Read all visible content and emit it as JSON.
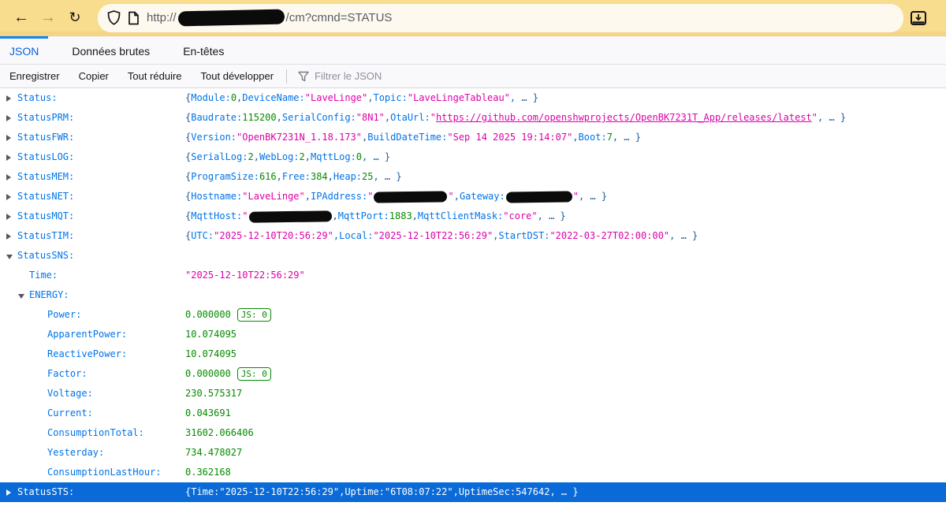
{
  "colors": {
    "chrome_yellow": "#f9dd8e",
    "urlbar_cream": "#fdf9ee",
    "accent_blue": "#0a84ff",
    "key_blue": "#0074e8",
    "string_magenta": "#dd00a9",
    "number_green": "#058b00",
    "selection_blue": "#0a6bd8"
  },
  "browser": {
    "back_icon": "←",
    "forward_icon": "→",
    "reload_icon": "↻",
    "url_prefix": "http://",
    "url_suffix": "/cm?cmnd=STATUS"
  },
  "tabs": [
    {
      "label": "JSON",
      "active": true
    },
    {
      "label": "Données brutes",
      "active": false
    },
    {
      "label": "En-têtes",
      "active": false
    }
  ],
  "toolbar": {
    "save_label": "Enregistrer",
    "copy_label": "Copier",
    "collapse_label": "Tout réduire",
    "expand_label": "Tout développer",
    "filter_placeholder": "Filtrer le JSON"
  },
  "json_tree": {
    "rows": [
      {
        "name": "Status:",
        "level": 0,
        "twisty": "c",
        "selected": false,
        "parts": [
          {
            "t": "d",
            "v": "{ "
          },
          {
            "t": "k",
            "v": "Module: "
          },
          {
            "t": "n",
            "v": "0"
          },
          {
            "t": "d",
            "v": ", "
          },
          {
            "t": "k",
            "v": "DeviceName: "
          },
          {
            "t": "s",
            "v": "\"LaveLinge\""
          },
          {
            "t": "d",
            "v": ", "
          },
          {
            "t": "k",
            "v": "Topic: "
          },
          {
            "t": "s",
            "v": "\"LaveLingeTableau\""
          },
          {
            "t": "d",
            "v": ", … }"
          }
        ]
      },
      {
        "name": "StatusPRM:",
        "level": 0,
        "twisty": "c",
        "selected": false,
        "parts": [
          {
            "t": "d",
            "v": "{ "
          },
          {
            "t": "k",
            "v": "Baudrate: "
          },
          {
            "t": "n",
            "v": "115200"
          },
          {
            "t": "d",
            "v": ", "
          },
          {
            "t": "k",
            "v": "SerialConfig: "
          },
          {
            "t": "s",
            "v": "\"8N1\""
          },
          {
            "t": "d",
            "v": ", "
          },
          {
            "t": "k",
            "v": "OtaUrl: "
          },
          {
            "t": "s",
            "v": "\""
          },
          {
            "t": "l",
            "v": "https://github.com/openshwprojects/OpenBK7231T_App/releases/latest"
          },
          {
            "t": "s",
            "v": "\""
          },
          {
            "t": "d",
            "v": ", … }"
          }
        ]
      },
      {
        "name": "StatusFWR:",
        "level": 0,
        "twisty": "c",
        "selected": false,
        "parts": [
          {
            "t": "d",
            "v": "{ "
          },
          {
            "t": "k",
            "v": "Version: "
          },
          {
            "t": "s",
            "v": "\"OpenBK7231N_1.18.173\""
          },
          {
            "t": "d",
            "v": ", "
          },
          {
            "t": "k",
            "v": "BuildDateTime: "
          },
          {
            "t": "s",
            "v": "\"Sep 14 2025 19:14:07\""
          },
          {
            "t": "d",
            "v": ", "
          },
          {
            "t": "k",
            "v": "Boot: "
          },
          {
            "t": "n",
            "v": "7"
          },
          {
            "t": "d",
            "v": ", … }"
          }
        ]
      },
      {
        "name": "StatusLOG:",
        "level": 0,
        "twisty": "c",
        "selected": false,
        "parts": [
          {
            "t": "d",
            "v": "{ "
          },
          {
            "t": "k",
            "v": "SerialLog: "
          },
          {
            "t": "n",
            "v": "2"
          },
          {
            "t": "d",
            "v": ", "
          },
          {
            "t": "k",
            "v": "WebLog: "
          },
          {
            "t": "n",
            "v": "2"
          },
          {
            "t": "d",
            "v": ", "
          },
          {
            "t": "k",
            "v": "MqttLog: "
          },
          {
            "t": "n",
            "v": "0"
          },
          {
            "t": "d",
            "v": ", … }"
          }
        ]
      },
      {
        "name": "StatusMEM:",
        "level": 0,
        "twisty": "c",
        "selected": false,
        "parts": [
          {
            "t": "d",
            "v": "{ "
          },
          {
            "t": "k",
            "v": "ProgramSize: "
          },
          {
            "t": "n",
            "v": "616"
          },
          {
            "t": "d",
            "v": ", "
          },
          {
            "t": "k",
            "v": "Free: "
          },
          {
            "t": "n",
            "v": "384"
          },
          {
            "t": "d",
            "v": ", "
          },
          {
            "t": "k",
            "v": "Heap: "
          },
          {
            "t": "n",
            "v": "25"
          },
          {
            "t": "d",
            "v": ", … }"
          }
        ]
      },
      {
        "name": "StatusNET:",
        "level": 0,
        "twisty": "c",
        "selected": false,
        "parts": [
          {
            "t": "d",
            "v": "{ "
          },
          {
            "t": "k",
            "v": "Hostname: "
          },
          {
            "t": "s",
            "v": "\"LaveLinge\""
          },
          {
            "t": "d",
            "v": ", "
          },
          {
            "t": "k",
            "v": "IPAddress: "
          },
          {
            "t": "s",
            "v": "\""
          },
          {
            "t": "r",
            "v": 93
          },
          {
            "t": "s",
            "v": "\""
          },
          {
            "t": "d",
            "v": ", "
          },
          {
            "t": "k",
            "v": "Gateway: "
          },
          {
            "t": "r",
            "v": 84
          },
          {
            "t": "s",
            "v": "\""
          },
          {
            "t": "d",
            "v": ", … }"
          }
        ]
      },
      {
        "name": "StatusMQT:",
        "level": 0,
        "twisty": "c",
        "selected": false,
        "parts": [
          {
            "t": "d",
            "v": "{ "
          },
          {
            "t": "k",
            "v": "MqttHost: "
          },
          {
            "t": "s",
            "v": "\""
          },
          {
            "t": "r",
            "v": 105
          },
          {
            "t": "d",
            "v": ", "
          },
          {
            "t": "k",
            "v": "MqttPort: "
          },
          {
            "t": "n",
            "v": "1883"
          },
          {
            "t": "d",
            "v": ", "
          },
          {
            "t": "k",
            "v": "MqttClientMask: "
          },
          {
            "t": "s",
            "v": "\"core\""
          },
          {
            "t": "d",
            "v": ", … }"
          }
        ]
      },
      {
        "name": "StatusTIM:",
        "level": 0,
        "twisty": "c",
        "selected": false,
        "parts": [
          {
            "t": "d",
            "v": "{ "
          },
          {
            "t": "k",
            "v": "UTC: "
          },
          {
            "t": "s",
            "v": "\"2025-12-10T20:56:29\""
          },
          {
            "t": "d",
            "v": ", "
          },
          {
            "t": "k",
            "v": "Local: "
          },
          {
            "t": "s",
            "v": "\"2025-12-10T22:56:29\""
          },
          {
            "t": "d",
            "v": ", "
          },
          {
            "t": "k",
            "v": "StartDST: "
          },
          {
            "t": "s",
            "v": "\"2022-03-27T02:00:00\""
          },
          {
            "t": "d",
            "v": ", … }"
          }
        ]
      },
      {
        "name": "StatusSNS:",
        "level": 0,
        "twisty": "e",
        "selected": false,
        "parts": []
      },
      {
        "name": "Time:",
        "level": 1,
        "twisty": "n",
        "selected": false,
        "parts": [
          {
            "t": "s",
            "v": "\"2025-12-10T22:56:29\""
          }
        ]
      },
      {
        "name": "ENERGY:",
        "level": 1,
        "twisty": "e",
        "selected": false,
        "parts": []
      },
      {
        "name": "Power:",
        "level": 2,
        "twisty": "n",
        "selected": false,
        "parts": [
          {
            "t": "n",
            "v": "0.000000"
          },
          {
            "t": "b",
            "v": "JS: 0"
          }
        ]
      },
      {
        "name": "ApparentPower:",
        "level": 2,
        "twisty": "n",
        "selected": false,
        "parts": [
          {
            "t": "n",
            "v": "10.074095"
          }
        ]
      },
      {
        "name": "ReactivePower:",
        "level": 2,
        "twisty": "n",
        "selected": false,
        "parts": [
          {
            "t": "n",
            "v": "10.074095"
          }
        ]
      },
      {
        "name": "Factor:",
        "level": 2,
        "twisty": "n",
        "selected": false,
        "parts": [
          {
            "t": "n",
            "v": "0.000000"
          },
          {
            "t": "b",
            "v": "JS: 0"
          }
        ]
      },
      {
        "name": "Voltage:",
        "level": 2,
        "twisty": "n",
        "selected": false,
        "parts": [
          {
            "t": "n",
            "v": "230.575317"
          }
        ]
      },
      {
        "name": "Current:",
        "level": 2,
        "twisty": "n",
        "selected": false,
        "parts": [
          {
            "t": "n",
            "v": "0.043691"
          }
        ]
      },
      {
        "name": "ConsumptionTotal:",
        "level": 2,
        "twisty": "n",
        "selected": false,
        "parts": [
          {
            "t": "n",
            "v": "31602.066406"
          }
        ]
      },
      {
        "name": "Yesterday:",
        "level": 2,
        "twisty": "n",
        "selected": false,
        "parts": [
          {
            "t": "n",
            "v": "734.478027"
          }
        ]
      },
      {
        "name": "ConsumptionLastHour:",
        "level": 2,
        "twisty": "n",
        "selected": false,
        "parts": [
          {
            "t": "n",
            "v": "0.362168"
          }
        ]
      },
      {
        "name": "StatusSTS:",
        "level": 0,
        "twisty": "c",
        "selected": true,
        "parts": [
          {
            "t": "d",
            "v": "{ "
          },
          {
            "t": "k",
            "v": "Time: "
          },
          {
            "t": "s",
            "v": "\"2025-12-10T22:56:29\""
          },
          {
            "t": "d",
            "v": ", "
          },
          {
            "t": "k",
            "v": "Uptime: "
          },
          {
            "t": "s",
            "v": "\"6T08:07:22\""
          },
          {
            "t": "d",
            "v": ", "
          },
          {
            "t": "k",
            "v": "UptimeSec: "
          },
          {
            "t": "n",
            "v": "547642"
          },
          {
            "t": "d",
            "v": ", … }"
          }
        ]
      }
    ]
  }
}
